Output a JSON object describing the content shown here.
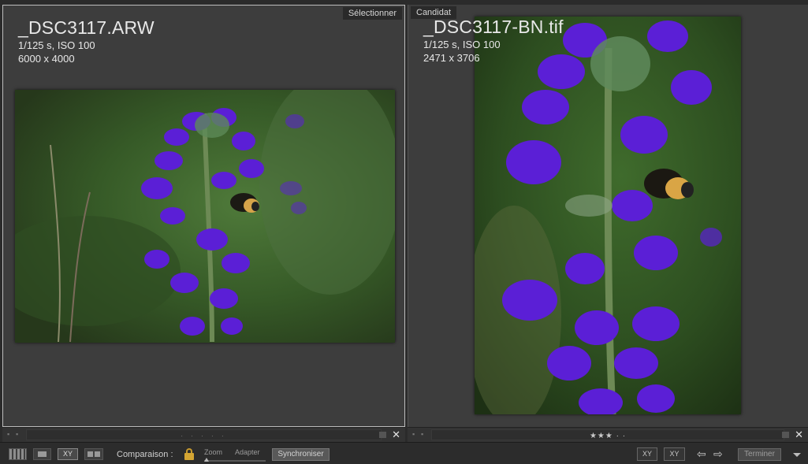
{
  "left_pane": {
    "tag": "Sélectionner",
    "filename": "_DSC3117.ARW",
    "exposure": "1/125 s, ISO 100",
    "dimensions": "6000 x 4000",
    "status_indicator": "· · · · ·"
  },
  "right_pane": {
    "tag": "Candidat",
    "filename": "_DSC3117-BN.tif",
    "exposure": "1/125 s, ISO 100",
    "dimensions": "2471 x 3706",
    "rating": "★★★ · ·"
  },
  "toolbar": {
    "xy_label": "XY",
    "compare_label": "Comparaison :",
    "zoom_label": "Zoom",
    "fit_label": "Adapter",
    "sync_label": "Synchroniser",
    "swap_label": "XY",
    "promote_label": "XY",
    "done_label": "Terminer",
    "close_glyph": "✕"
  },
  "icons": {
    "grid": "grid-view-icon",
    "loupe": "loupe-view-icon",
    "compare": "compare-view-icon",
    "survey": "survey-view-icon",
    "lock": "lock-icon",
    "swap": "swap-icon",
    "promote": "make-select-icon",
    "prev": "arrow-left-icon",
    "next": "arrow-right-icon",
    "menu": "chevron-down-icon"
  },
  "colors": {
    "lock": "#d4a533",
    "flower": "#5b1fd6",
    "foliage": "#3f6b2c"
  }
}
